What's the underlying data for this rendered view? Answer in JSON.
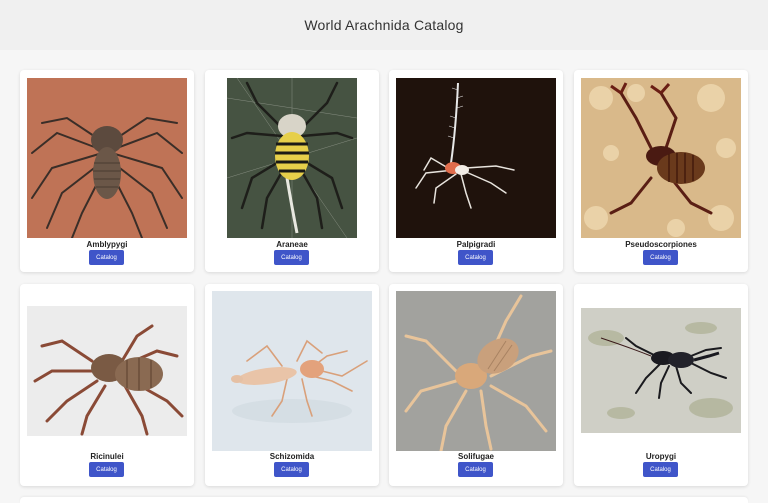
{
  "header": {
    "title": "World Arachnida Catalog"
  },
  "cards": [
    {
      "name": "Amblypygi",
      "button": "Catalog",
      "image_alt": "Amblypygi"
    },
    {
      "name": "Araneae",
      "button": "Catalog",
      "image_alt": "Araneae"
    },
    {
      "name": "Palpigradi",
      "button": "Catalog",
      "image_alt": "Palpigradi"
    },
    {
      "name": "Pseudoscorpiones",
      "button": "Catalog",
      "image_alt": "Pseudoscorpiones"
    },
    {
      "name": "Ricinulei",
      "button": "Catalog",
      "image_alt": "Ricinulei"
    },
    {
      "name": "Schizomida",
      "button": "Catalog",
      "image_alt": "Schizomida"
    },
    {
      "name": "Solifugae",
      "button": "Catalog",
      "image_alt": "Solifugae"
    },
    {
      "name": "Uropygi",
      "button": "Catalog",
      "image_alt": "Uropygi"
    }
  ],
  "colors": {
    "button_bg": "#3f55c9",
    "card_bg": "#ffffff",
    "page_bg": "#f6f6f6"
  }
}
